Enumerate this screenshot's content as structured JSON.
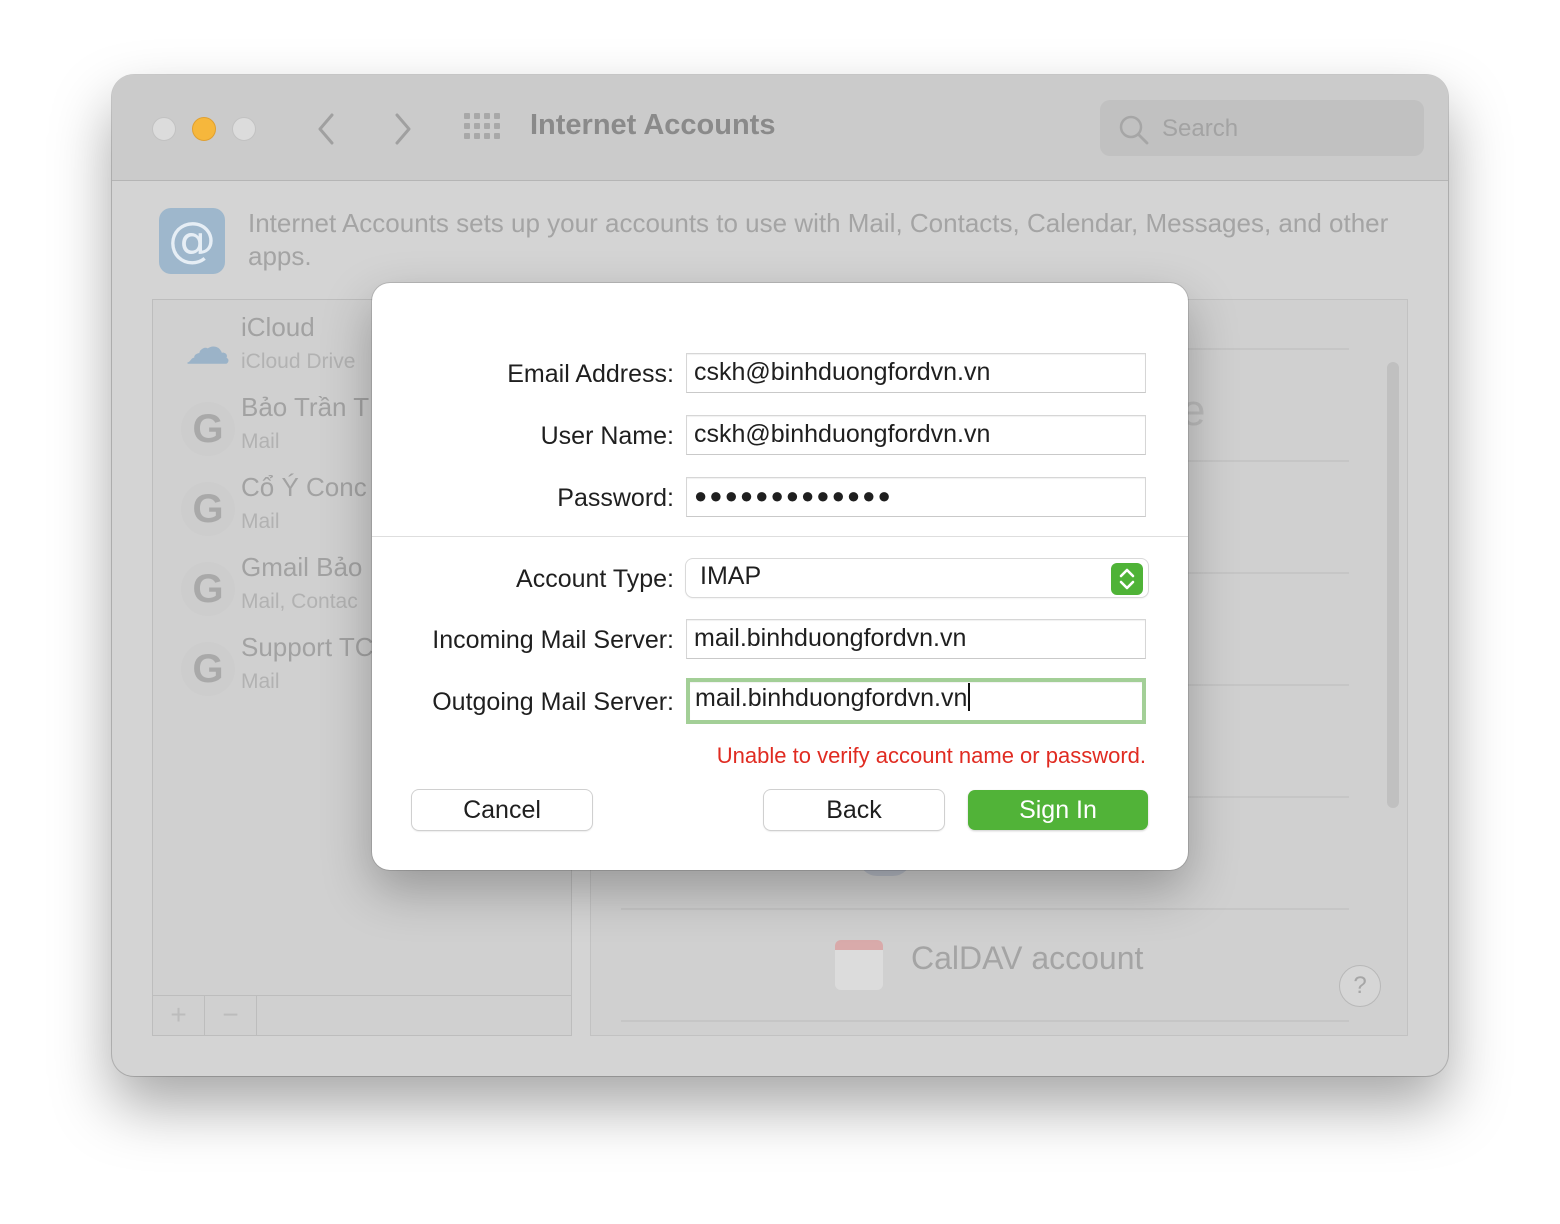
{
  "window": {
    "title": "Internet Accounts",
    "search_placeholder": "Search",
    "description": "Internet Accounts sets up your accounts to use with Mail, Contacts, Calendar, Messages, and other apps."
  },
  "accounts": [
    {
      "name": "iCloud",
      "detail": "iCloud Drive",
      "icon": "icloud-icon"
    },
    {
      "name": "Bảo Trần T",
      "detail": "Mail",
      "icon": "google-icon"
    },
    {
      "name": "Cổ Ý Conc",
      "detail": "Mail",
      "icon": "google-icon"
    },
    {
      "name": "Gmail Bảo",
      "detail": "Mail, Contac",
      "icon": "google-icon"
    },
    {
      "name": "Support TC",
      "detail": "Mail",
      "icon": "google-icon"
    }
  ],
  "account_list_controls": {
    "add": "+",
    "remove": "−"
  },
  "provider_list": {
    "caldav": "CalDAV account",
    "help": "?",
    "partial_text": "e"
  },
  "dialog": {
    "email_label": "Email Address:",
    "email_value": "cskh@binhduongfordvn.vn",
    "username_label": "User Name:",
    "username_value": "cskh@binhduongfordvn.vn",
    "password_label": "Password:",
    "password_value": "●●●●●●●●●●●●●",
    "account_type_label": "Account Type:",
    "account_type_value": "IMAP",
    "incoming_label": "Incoming Mail Server:",
    "incoming_value": "mail.binhduongfordvn.vn",
    "outgoing_label": "Outgoing Mail Server:",
    "outgoing_value": "mail.binhduongfordvn.vn",
    "error": "Unable to verify account name or password.",
    "cancel": "Cancel",
    "back": "Back",
    "sign_in": "Sign In"
  },
  "colors": {
    "accent_green": "#51b338",
    "error_red": "#e02b21",
    "focus_ring": "#a3cf97",
    "minimize_yellow": "#f6b73c"
  }
}
